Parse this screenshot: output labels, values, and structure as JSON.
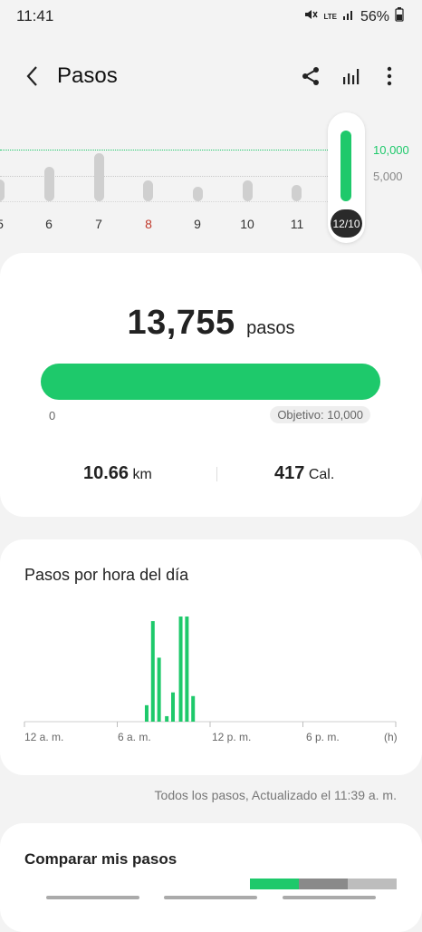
{
  "status": {
    "time": "11:41",
    "network": "LTE",
    "battery": "56%"
  },
  "header": {
    "title": "Pasos"
  },
  "week": {
    "days": [
      "5",
      "6",
      "7",
      "8",
      "9",
      "10",
      "11",
      "12/10"
    ],
    "target_high": "10,000",
    "target_low": "5,000"
  },
  "summary": {
    "steps": "13,755",
    "steps_unit": "pasos",
    "progress_start": "0",
    "goal": "Objetivo: 10,000",
    "progress_fraction": 1.0,
    "distance_value": "10.66",
    "distance_unit": "km",
    "calories_value": "417",
    "calories_unit": "Cal."
  },
  "hourly": {
    "title": "Pasos por hora del día",
    "axis_labels": [
      "12 a. m.",
      "6 a. m.",
      "12 p. m.",
      "6 p. m.",
      "(h)"
    ],
    "footnote": "Todos los pasos, Actualizado el 11:39 a. m."
  },
  "compare": {
    "title": "Comparar mis pasos"
  },
  "colors": {
    "accent": "#1ec96b",
    "highlight_day": "#c0392b"
  },
  "chart_data": {
    "type": "bar",
    "title": "Pasos por hora del día",
    "xlabel": "(h)",
    "ylabel": "",
    "x_ticks": [
      "12 a. m.",
      "6 a. m.",
      "12 p. m.",
      "6 p. m."
    ],
    "categories": [
      "0",
      "1",
      "2",
      "3",
      "4",
      "5",
      "6",
      "7",
      "8",
      "9",
      "10",
      "11",
      "12",
      "13",
      "14",
      "15",
      "16",
      "17",
      "18",
      "19",
      "20",
      "21",
      "22",
      "23"
    ],
    "values": [
      0,
      0,
      0,
      0,
      0,
      0,
      0,
      0,
      200,
      1150,
      0,
      0,
      0,
      0,
      0,
      0,
      0,
      0,
      0,
      0,
      0,
      0,
      0,
      0
    ],
    "series_fine": [
      {
        "hour": 7.9,
        "value": 180
      },
      {
        "hour": 8.3,
        "value": 1100
      },
      {
        "hour": 8.7,
        "value": 700
      },
      {
        "hour": 9.2,
        "value": 60
      },
      {
        "hour": 9.6,
        "value": 320
      },
      {
        "hour": 10.1,
        "value": 1150
      },
      {
        "hour": 10.5,
        "value": 1150
      },
      {
        "hour": 10.9,
        "value": 280
      }
    ],
    "ylim": [
      0,
      1200
    ]
  }
}
